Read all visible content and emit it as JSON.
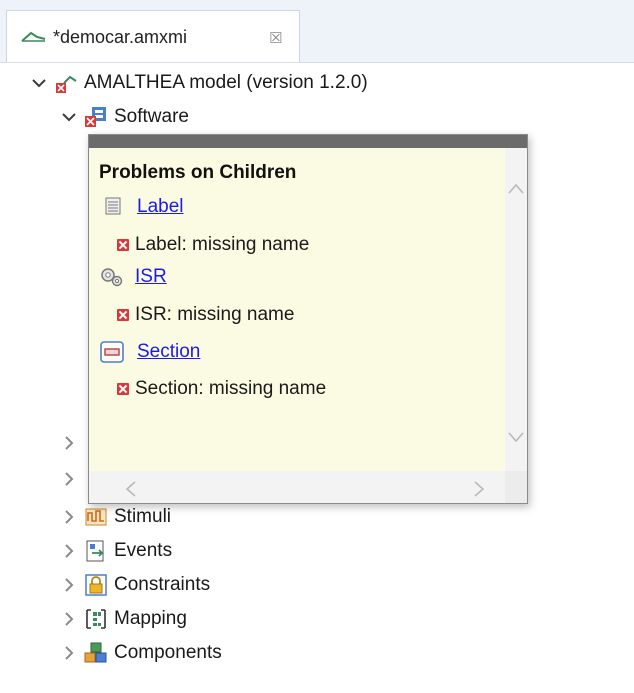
{
  "tab": {
    "title": "*democar.amxmi",
    "close": "☒"
  },
  "tree": {
    "root": {
      "label": "AMALTHEA model (version 1.2.0)"
    },
    "software": {
      "label": "Software"
    },
    "items": [
      {
        "label": "Stimuli",
        "icon": "stimuli-icon"
      },
      {
        "label": "Events",
        "icon": "events-icon"
      },
      {
        "label": "Constraints",
        "icon": "constraints-icon"
      },
      {
        "label": "Mapping",
        "icon": "mapping-icon"
      },
      {
        "label": "Components",
        "icon": "components-icon"
      }
    ]
  },
  "popup": {
    "heading": "Problems on Children",
    "entries": [
      {
        "link": "Label",
        "problem": "Label: missing name",
        "icon": "label-icon"
      },
      {
        "link": "ISR",
        "problem": "ISR: missing name",
        "icon": "isr-icon"
      },
      {
        "link": "Section",
        "problem": "Section: missing name",
        "icon": "section-icon"
      }
    ]
  },
  "colors": {
    "error": "#d73a3a",
    "link": "#1a1aee",
    "popup_bg": "#fbfbe3",
    "tab_bar": "#eef3fa"
  }
}
